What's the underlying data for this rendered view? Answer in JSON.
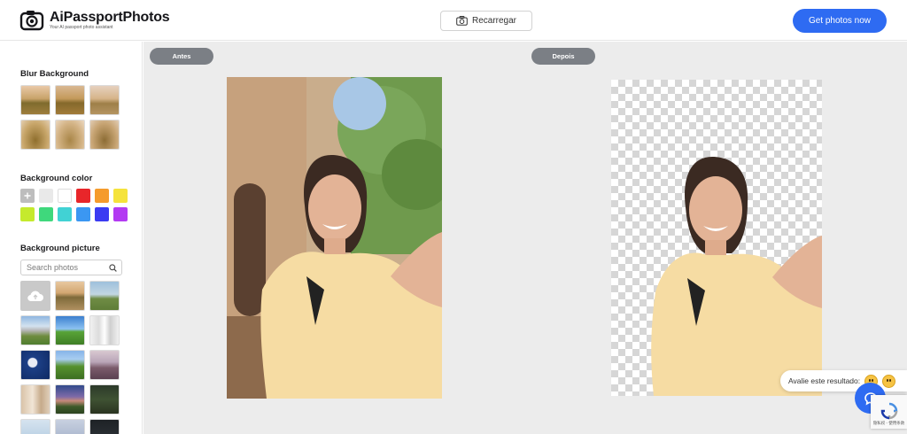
{
  "header": {
    "logo_title": "AiPassportPhotos",
    "logo_subtitle": "Your AI passport photo assistant",
    "reload_label": "Recarregar",
    "cta_label": "Get photos now",
    "accent_color": "#2e6bf2"
  },
  "sidebar": {
    "blur_title": "Blur Background",
    "color_title": "Background color",
    "picture_title": "Background picture",
    "search_placeholder": "Search photos",
    "colors": [
      "add",
      "#e9e9e9",
      "#ffffff",
      "#e8262a",
      "#f59b2c",
      "#f5e33c",
      "#c5ea2d",
      "#3fd87c",
      "#41d2d4",
      "#3b97f2",
      "#3b3bf2",
      "#b33bf2"
    ]
  },
  "main": {
    "before_label": "Antes",
    "after_label": "Depois"
  },
  "rating": {
    "prompt": "Avalie este resultado:"
  },
  "recaptcha": {
    "text": "隐私权 - 使用条款"
  }
}
